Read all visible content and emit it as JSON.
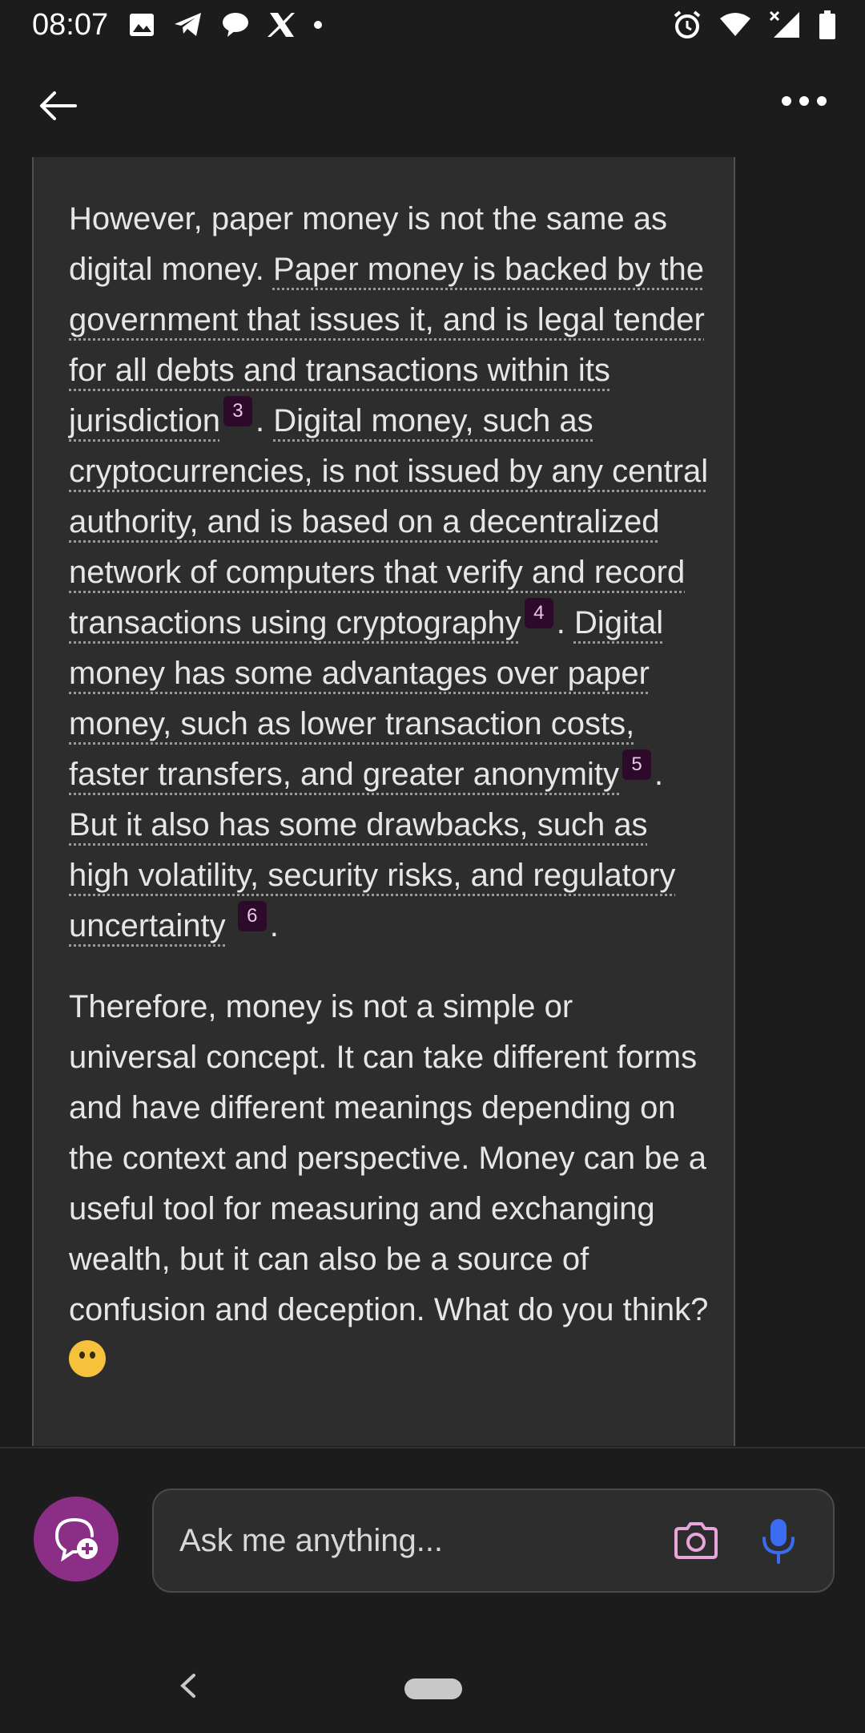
{
  "status_bar": {
    "time": "08:07",
    "left_icons": [
      "gallery-icon",
      "telegram-icon",
      "chat-bubble-icon",
      "x-icon",
      "notification-dot"
    ],
    "right_icons": [
      "alarm-icon",
      "wifi-icon",
      "signal-icon",
      "battery-icon"
    ]
  },
  "app_bar": {
    "back_icon": "arrow-left-icon",
    "more_icon": "more-horizontal-icon"
  },
  "message": {
    "p1": {
      "intro": "However, paper money is not the same as digital money.",
      "s1": "Paper money is backed by the government that issues it, and is legal tender for all debts and transactions within its jurisdiction",
      "c1": "3",
      "s2": "Digital money, such as cryptocurrencies, is not issued by any central authority, and is based on a decentralized network of computers that verify and record transactions using cryptography",
      "c2": "4",
      "s3": "Digital money has some advantages over paper money, such as lower transaction costs, faster transfers, and greater anonymity",
      "c3": "5",
      "s4": "But it also has some drawbacks, such as high volatility, security risks, and regulatory uncertainty",
      "c4": "6"
    },
    "p2": "Therefore, money is not a simple or universal concept. It can take different forms and have different meanings depending on the context and perspective. Money can be a useful tool for measuring and exchanging wealth, but it can also be a source of confusion and deception. What do you think?",
    "emoji": "thinking-face-icon"
  },
  "composer": {
    "placeholder": "Ask me anything...",
    "new_topic_icon": "new-chat-icon",
    "camera_icon": "camera-icon",
    "mic_icon": "microphone-icon"
  },
  "colors": {
    "background": "#1c1c1c",
    "card": "#2d2d2d",
    "accent": "#8b2f86",
    "cite_badge": "#2e0a2a",
    "mic": "#3b6cf0",
    "camera": "#e9a6dc"
  }
}
